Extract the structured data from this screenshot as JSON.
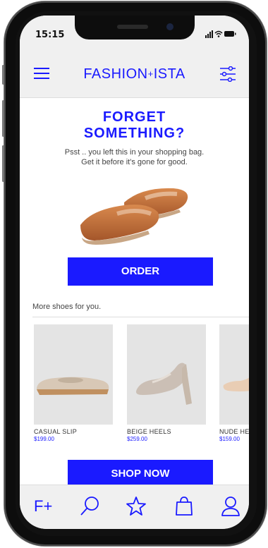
{
  "status": {
    "time": "15:15",
    "icons": "signal wifi battery"
  },
  "header": {
    "brand_left": "FASHION",
    "brand_plus": "+",
    "brand_right": "ISTA",
    "menu_icon": "hamburger-icon",
    "filter_icon": "sliders-icon"
  },
  "promo": {
    "title_line1": "FORGET",
    "title_line2": "SOMETHING?",
    "subtitle_line1": "Psst .. you left this in your shopping bag.",
    "subtitle_line2": "Get it before it's gone for good.",
    "order_label": "ORDER"
  },
  "more": {
    "label": "More shoes for you.",
    "products": [
      {
        "name": "CASUAL SLIP",
        "price": "$199.00"
      },
      {
        "name": "BEIGE HEELS",
        "price": "$259.00"
      },
      {
        "name": "NUDE HEELS",
        "price": "$159.00"
      }
    ],
    "shop_label": "SHOP NOW"
  },
  "tabs": [
    {
      "label": "F+",
      "icon": "brand-icon"
    },
    {
      "icon": "search-icon"
    },
    {
      "icon": "star-icon"
    },
    {
      "icon": "bag-icon"
    },
    {
      "icon": "user-icon"
    }
  ],
  "colors": {
    "accent": "#1a1aff",
    "bar": "#f0f0f0"
  }
}
